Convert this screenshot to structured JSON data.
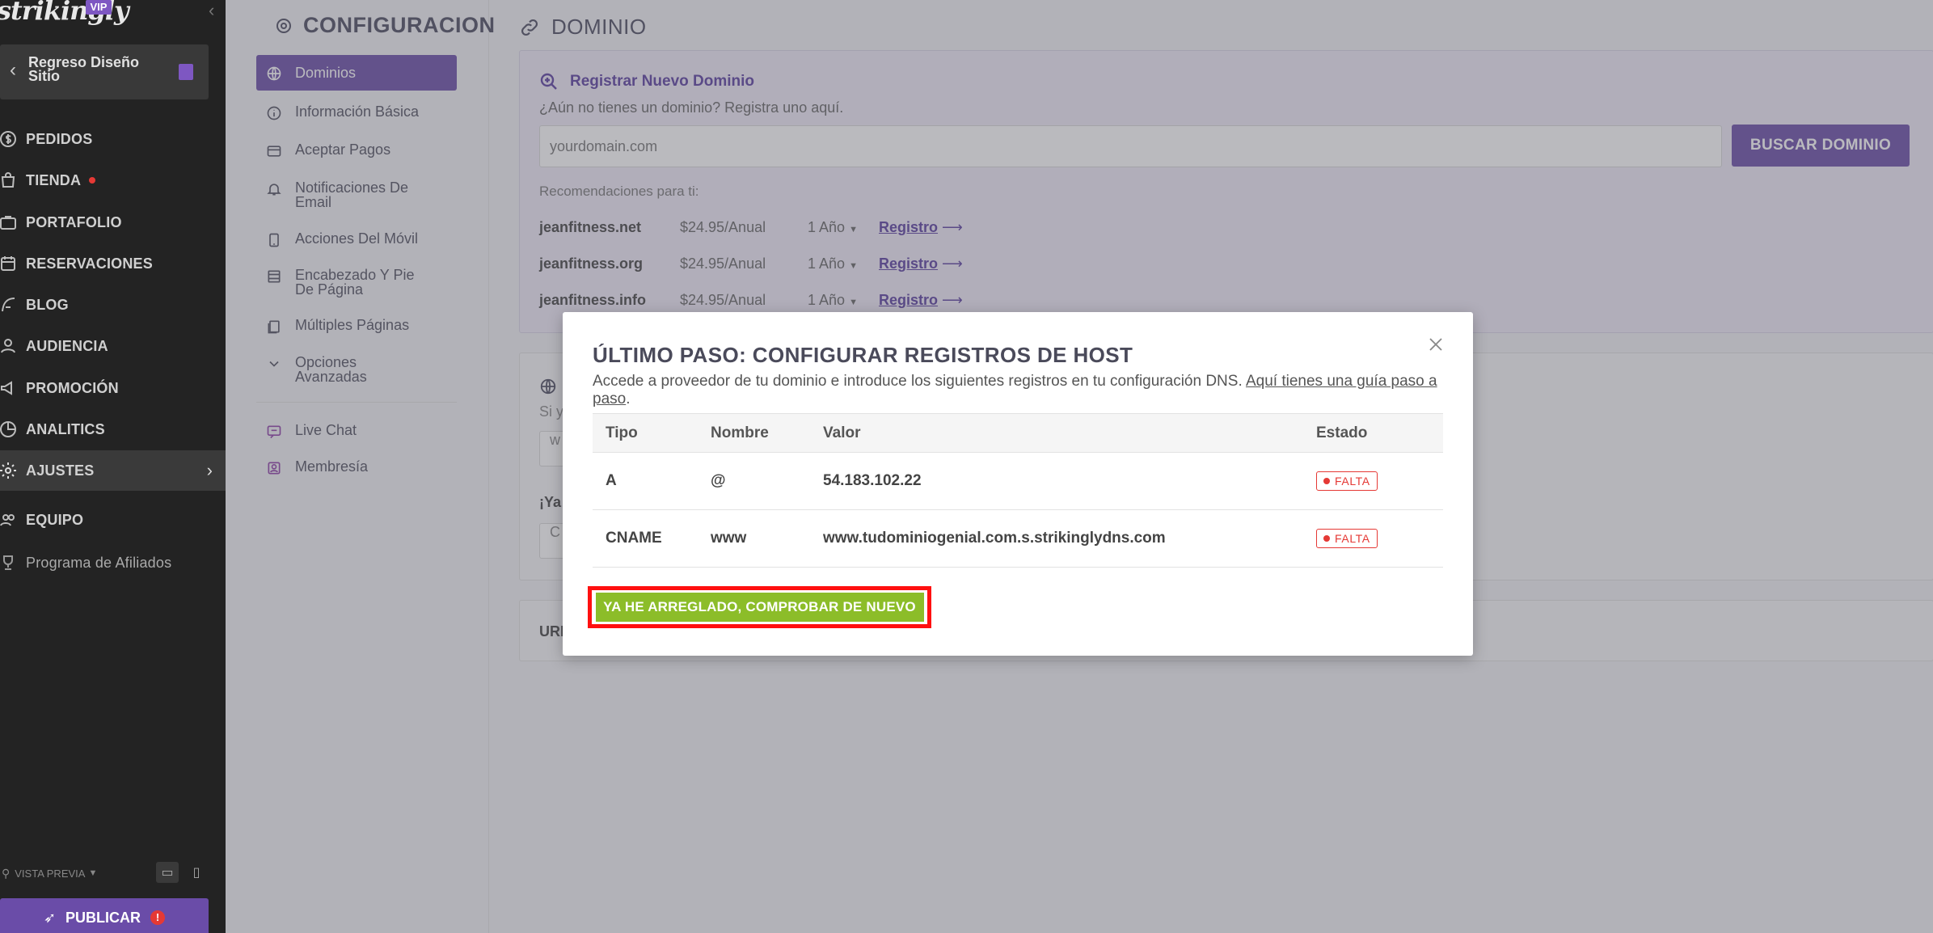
{
  "sidebar": {
    "logo": "strikingly",
    "vip": "VIP",
    "back_label": "Regreso Diseño Sitio",
    "items": [
      {
        "label": "PEDIDOS"
      },
      {
        "label": "TIENDA"
      },
      {
        "label": "PORTAFOLIO"
      },
      {
        "label": "RESERVACIONES"
      },
      {
        "label": "BLOG"
      },
      {
        "label": "AUDIENCIA"
      },
      {
        "label": "PROMOCIÓN"
      },
      {
        "label": "ANALITICS"
      },
      {
        "label": "AJUSTES"
      },
      {
        "label": "EQUIPO"
      },
      {
        "label": "Programa de Afiliados"
      }
    ],
    "preview_label": "VISTA PREVIA",
    "publish_label": "PUBLICAR",
    "publish_alert": "!"
  },
  "settings": {
    "title": "CONFIGURACION",
    "nav": [
      {
        "label": "Dominios"
      },
      {
        "label": "Información Básica"
      },
      {
        "label": "Aceptar Pagos"
      },
      {
        "label": "Notificaciones De Email"
      },
      {
        "label": "Acciones Del Móvil"
      },
      {
        "label": "Encabezado Y Pie De Página"
      },
      {
        "label": "Múltiples Páginas"
      },
      {
        "label": "Opciones Avanzadas"
      },
      {
        "label": "Live Chat"
      },
      {
        "label": "Membresía"
      }
    ]
  },
  "domain": {
    "header": "DOMINIO",
    "register_title": "Registrar Nuevo Dominio",
    "register_sub": "¿Aún no tienes un dominio? Registra uno aquí.",
    "input_placeholder": "yourdomain.com",
    "search_button": "BUSCAR DOMINIO",
    "reco_title": "Recomendaciones para ti:",
    "recommendations": [
      {
        "domain": "jeanfitness.net",
        "price": "$24.95/Anual",
        "years": "1 Año",
        "link": "Registro"
      },
      {
        "domain": "jeanfitness.org",
        "price": "$24.95/Anual",
        "years": "1 Año",
        "link": "Registro"
      },
      {
        "domain": "jeanfitness.info",
        "price": "$24.95/Anual",
        "years": "1 Año",
        "link": "Registro"
      }
    ],
    "connect_text": "Si y",
    "connect_input": "w",
    "connect_text2": "¡Ya",
    "connect_input2": "C",
    "url_text": "URL"
  },
  "modal": {
    "title": "ÚLTIMO PASO: CONFIGURAR REGISTROS DE HOST",
    "description": "Accede a proveedor de tu dominio e introduce los siguientes registros en tu configuración DNS.",
    "guide_link": "Aquí tienes una guía paso a paso",
    "guide_suffix": ".",
    "columns": [
      "Tipo",
      "Nombre",
      "Valor",
      "Estado"
    ],
    "rows": [
      {
        "tipo": "A",
        "nombre": "@",
        "valor": "54.183.102.22",
        "estado": "FALTA"
      },
      {
        "tipo": "CNAME",
        "nombre": "www",
        "valor": "www.tudominiogenial.com.s.strikinglydns.com",
        "estado": "FALTA"
      }
    ],
    "check_button": "YA HE ARREGLADO, COMPROBAR DE NUEVO"
  },
  "colors": {
    "accent": "#6a4ca8",
    "success": "#8cbd29",
    "error": "#e53935",
    "sidebar_bg": "#232323"
  }
}
